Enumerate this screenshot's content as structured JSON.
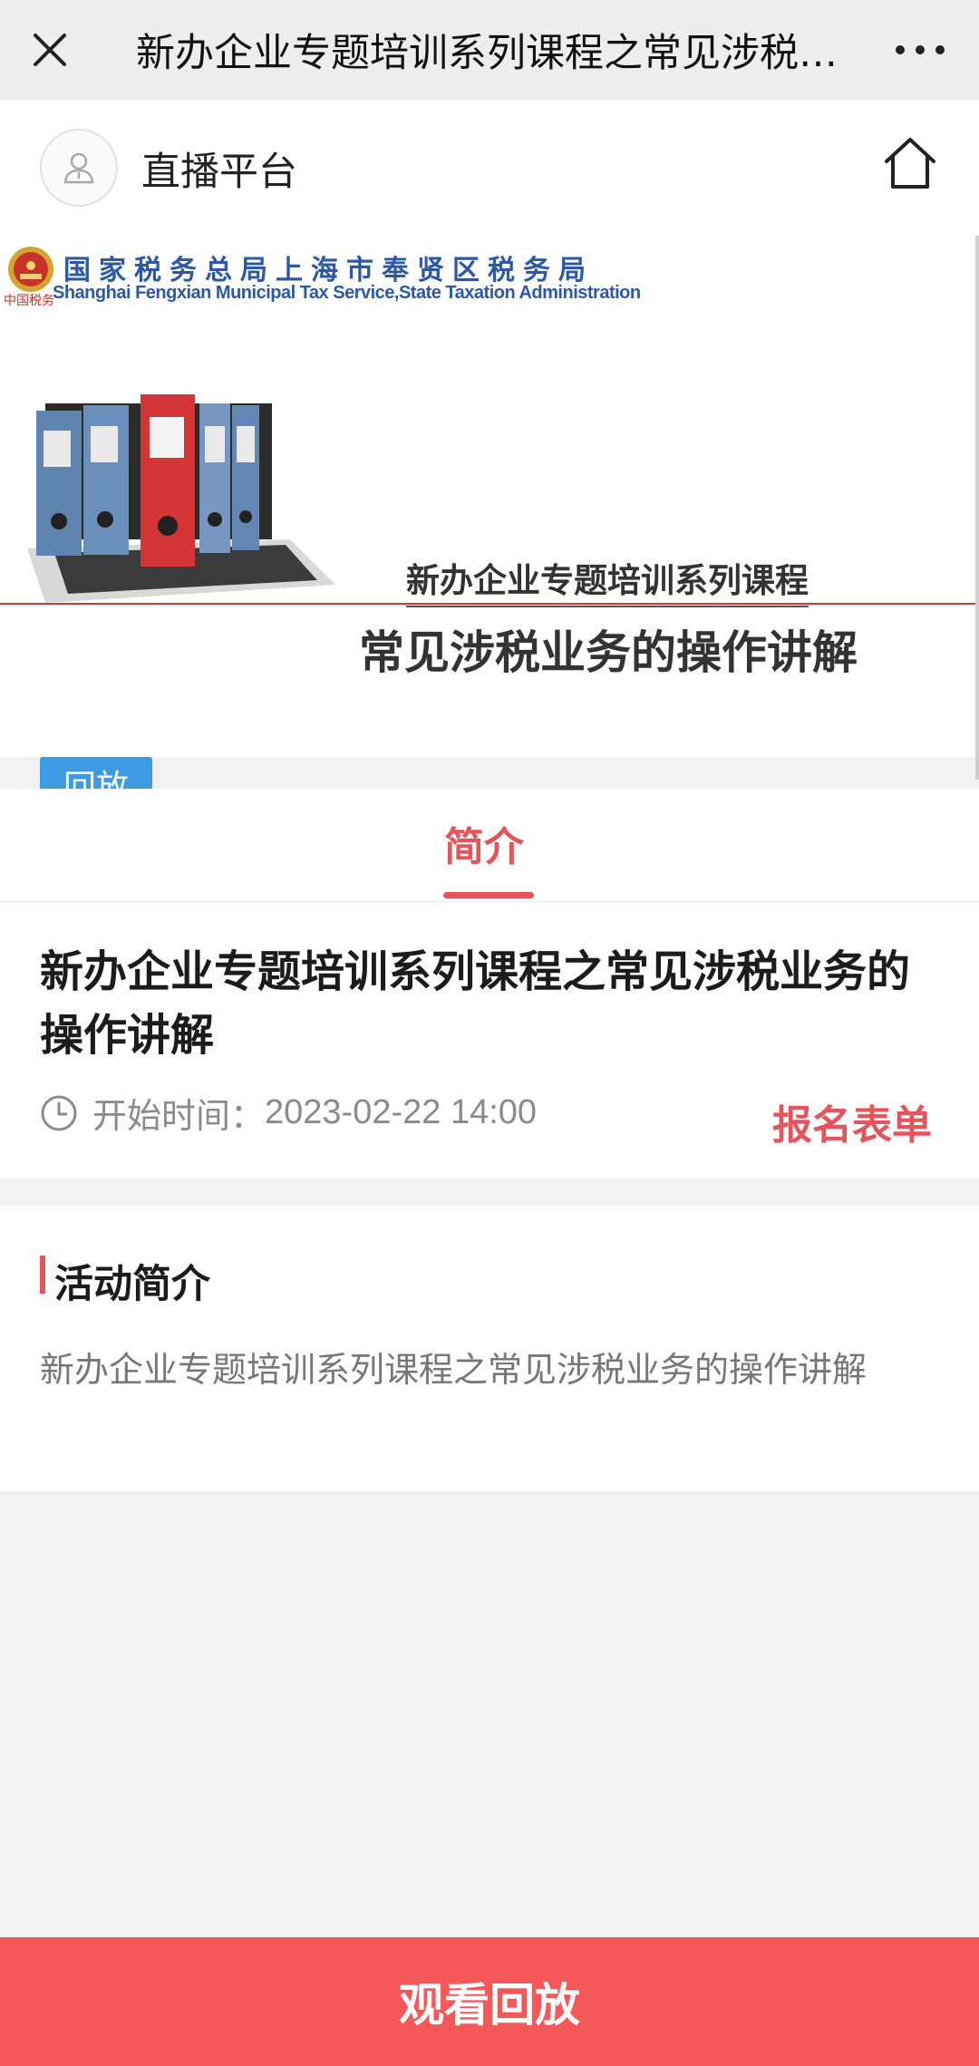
{
  "topbar": {
    "title": "新办企业专题培训系列课程之常见涉税业务的操作讲解",
    "close_icon": "close-icon",
    "more_icon": "more-icon"
  },
  "header": {
    "platform_name": "直播平台",
    "avatar_icon": "user-avatar-icon",
    "home_icon": "home-icon"
  },
  "banner": {
    "bureau_cn": "国家税务总局上海市奉贤区税务局",
    "bureau_en": "Shanghai Fengxian Municipal Tax Service,State Taxation Administration",
    "emblem_text": "中国税务",
    "subtitle": "新办企业专题培训系列课程",
    "main_title": "常见涉税业务的操作讲解"
  },
  "badge": {
    "label": "回放"
  },
  "tabs": [
    {
      "label": "简介",
      "active": true
    }
  ],
  "course": {
    "title": "新办企业专题培训系列课程之常见涉税业务的操作讲解",
    "time_label": "开始时间：",
    "time_value": "2023-02-22 14:00",
    "signup_label": "报名表单"
  },
  "activity": {
    "section_title": "活动简介",
    "description": "新办企业专题培训系列课程之常见涉税业务的操作讲解"
  },
  "footer": {
    "watch_label": "观看回放"
  },
  "colors": {
    "accent": "#e4545a",
    "button": "#f45859",
    "badge": "#3d9be4",
    "bureau_blue": "#2c58a6"
  }
}
